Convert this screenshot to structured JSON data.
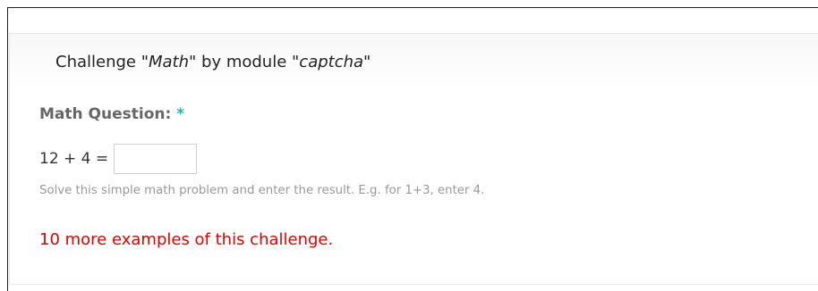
{
  "challenge": {
    "legend_prefix": "Challenge \"",
    "challenge_name": "Math",
    "legend_middle": "\" by module \"",
    "module_name": "captcha",
    "legend_suffix": "\""
  },
  "field": {
    "label": "Math Question:",
    "required_marker": "*",
    "question": "12 + 4 =",
    "answer_value": "",
    "description": "Solve this simple math problem and enter the result. E.g. for 1+3, enter 4."
  },
  "examples_link": {
    "text": "10 more examples of this challenge."
  },
  "colors": {
    "link": "#e00000",
    "required": "#00ccaa",
    "label": "#666666",
    "description": "#999999"
  }
}
